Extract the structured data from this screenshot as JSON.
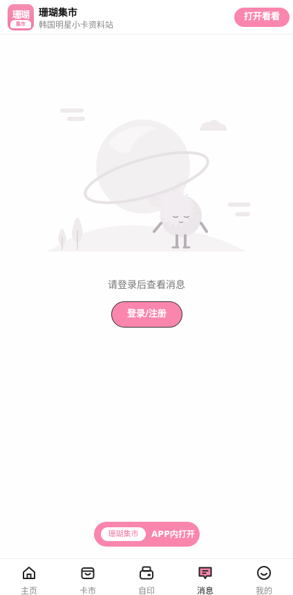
{
  "header": {
    "logo_text_top": "珊瑚",
    "logo_text_bottom": "集市",
    "app_name": "珊瑚集市",
    "app_subtitle": "韩国明星小卡资料站",
    "open_button": "打开看看"
  },
  "main": {
    "empty_message": "请登录后查看消息",
    "login_button": "登录/注册"
  },
  "app_pill": {
    "tag": "珊瑚集市",
    "text": "APP内打开"
  },
  "nav": {
    "items": [
      {
        "label": "主页",
        "icon": "home-icon"
      },
      {
        "label": "卡市",
        "icon": "basket-icon"
      },
      {
        "label": "自印",
        "icon": "printer-icon"
      },
      {
        "label": "消息",
        "icon": "message-icon",
        "active": true
      },
      {
        "label": "我的",
        "icon": "smile-icon"
      }
    ]
  },
  "colors": {
    "accent": "#fa86ad",
    "text_muted": "#888888",
    "nav_active": "#222222"
  }
}
